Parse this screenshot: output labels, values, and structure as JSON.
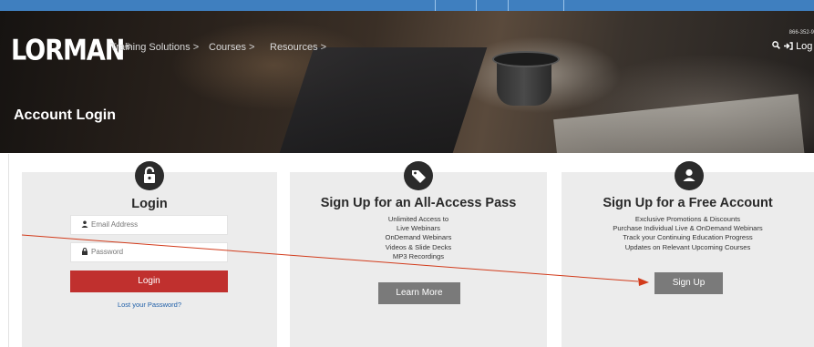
{
  "header": {
    "logo": "LORMAN",
    "logo_mark": "®",
    "nav": [
      "Training Solutions >",
      "Courses >",
      "Resources >"
    ],
    "phone": "866-352-9",
    "login_label": "Log",
    "page_title": "Account Login"
  },
  "login": {
    "title": "Login",
    "email_placeholder": "Email Address",
    "password_placeholder": "Password",
    "button": "Login",
    "lost_password": "Lost your Password?"
  },
  "all_access": {
    "title": "Sign Up for an All-Access Pass",
    "features": [
      "Unlimited Access to",
      "Live Webinars",
      "OnDemand Webinars",
      "Videos & Slide Decks",
      "MP3 Recordings"
    ],
    "button": "Learn More"
  },
  "free_account": {
    "title": "Sign Up for a Free Account",
    "features": [
      "Exclusive Promotions & Discounts",
      "Purchase Individual Live & OnDemand Webinars",
      "Track your Continuing Education Progress",
      "Updates on Relevant Upcoming Courses"
    ],
    "button": "Sign Up"
  },
  "colors": {
    "accent_red": "#c0302e",
    "card_bg": "#ececec",
    "top_strip": "#3f7fbf",
    "link_blue": "#1f5fa8"
  },
  "icons": [
    "lock-icon",
    "tag-icon",
    "user-icon",
    "search-icon",
    "sign-in-icon",
    "person-icon"
  ]
}
